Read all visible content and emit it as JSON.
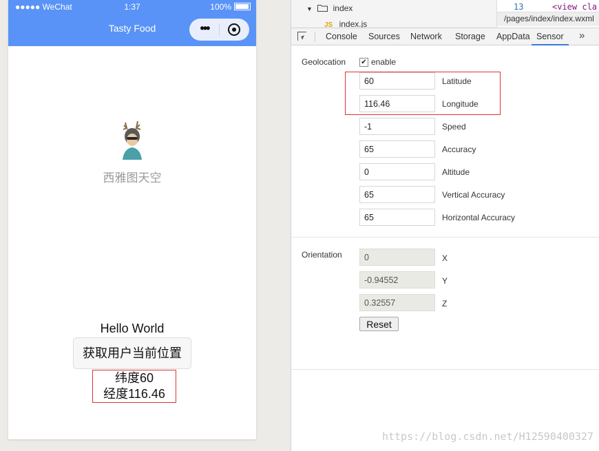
{
  "phone": {
    "status_left": "●●●●● WeChat",
    "time": "1:37",
    "battery": "100%",
    "nav_title": "Tasty Food",
    "capsule_more": "•••",
    "nickname": "西雅图天空",
    "hello": "Hello World",
    "locate_button": "获取用户当前位置",
    "latitude_text": "纬度60",
    "longitude_text": "经度116.46"
  },
  "devtools": {
    "tree": {
      "folder": "index",
      "file": "index.js"
    },
    "code": {
      "line_number": "13",
      "text": "<view cla",
      "path": "/pages/index/index.wxml"
    },
    "tabs": [
      "Console",
      "Sources",
      "Network",
      "Storage",
      "AppData",
      "Sensor"
    ],
    "active_tab": "Sensor",
    "more": "»",
    "geolocation": {
      "section_label": "Geolocation",
      "enable_label": "enable",
      "enabled": true,
      "fields": [
        {
          "label": "Latitude",
          "value": "60"
        },
        {
          "label": "Longitude",
          "value": "116.46"
        },
        {
          "label": "Speed",
          "value": "-1"
        },
        {
          "label": "Accuracy",
          "value": "65"
        },
        {
          "label": "Altitude",
          "value": "0"
        },
        {
          "label": "Vertical Accuracy",
          "value": "65"
        },
        {
          "label": "Horizontal Accuracy",
          "value": "65"
        }
      ]
    },
    "orientation": {
      "section_label": "Orientation",
      "fields": [
        {
          "label": "X",
          "value": "0"
        },
        {
          "label": "Y",
          "value": "-0.94552"
        },
        {
          "label": "Z",
          "value": "0.32557"
        }
      ],
      "reset_label": "Reset"
    }
  },
  "watermark": "https://blog.csdn.net/H12590400327",
  "colors": {
    "nav_blue": "#5993f7",
    "highlight_red": "#dd3333",
    "tab_accent": "#3879d9"
  }
}
